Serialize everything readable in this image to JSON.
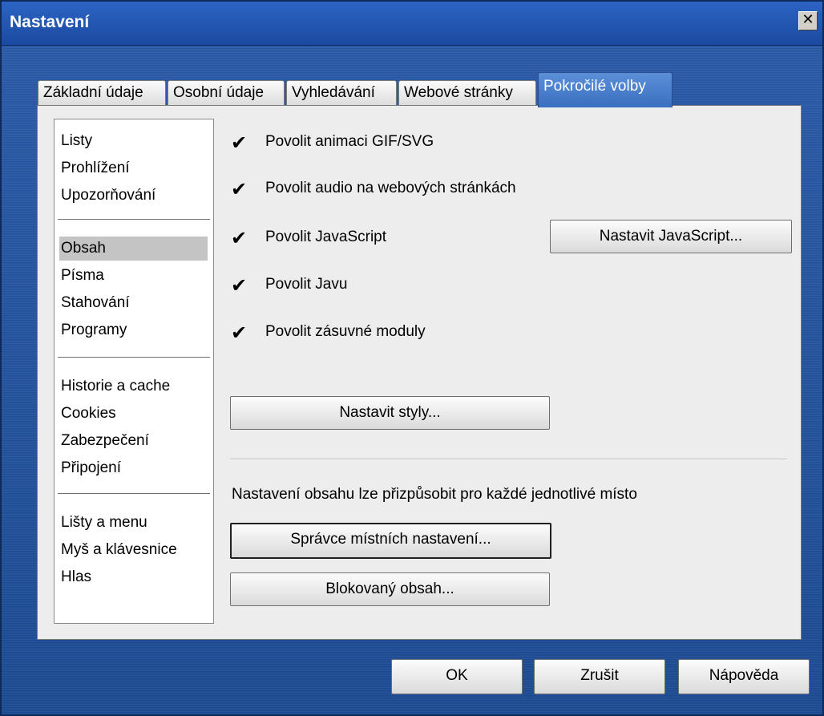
{
  "window": {
    "title": "Nastavení",
    "close_label": "✕"
  },
  "tabs": [
    {
      "label": "Základní údaje"
    },
    {
      "label": "Osobní údaje"
    },
    {
      "label": "Vyhledávání"
    },
    {
      "label": "Webové stránky"
    },
    {
      "label": "Pokročilé volby",
      "active": true
    }
  ],
  "sidebar": {
    "groups": [
      [
        "Listy",
        "Prohlížení",
        "Upozorňování"
      ],
      [
        "Obsah",
        "Písma",
        "Stahování",
        "Programy"
      ],
      [
        "Historie a cache",
        "Cookies",
        "Zabezpečení",
        "Připojení"
      ],
      [
        "Lišty a menu",
        "Myš a klávesnice",
        "Hlas"
      ]
    ],
    "selected": "Obsah"
  },
  "options": [
    {
      "label": "Povolit animaci GIF/SVG",
      "checked": true
    },
    {
      "label": "Povolit audio na webových stránkách",
      "checked": true
    },
    {
      "label": "Povolit JavaScript",
      "checked": true
    },
    {
      "label": "Povolit Javu",
      "checked": true
    },
    {
      "label": "Povolit zásuvné moduly",
      "checked": true
    }
  ],
  "buttons": {
    "javascript": "Nastavit JavaScript...",
    "styles": "Nastavit styly...",
    "site_prefs": "Správce místních nastavení...",
    "blocked": "Blokovaný obsah..."
  },
  "info_text": "Nastavení obsahu lze přizpůsobit pro každé jednotlivé místo",
  "dialog_buttons": {
    "ok": "OK",
    "cancel": "Zrušit",
    "help": "Nápověda"
  },
  "check_glyph": "✔"
}
